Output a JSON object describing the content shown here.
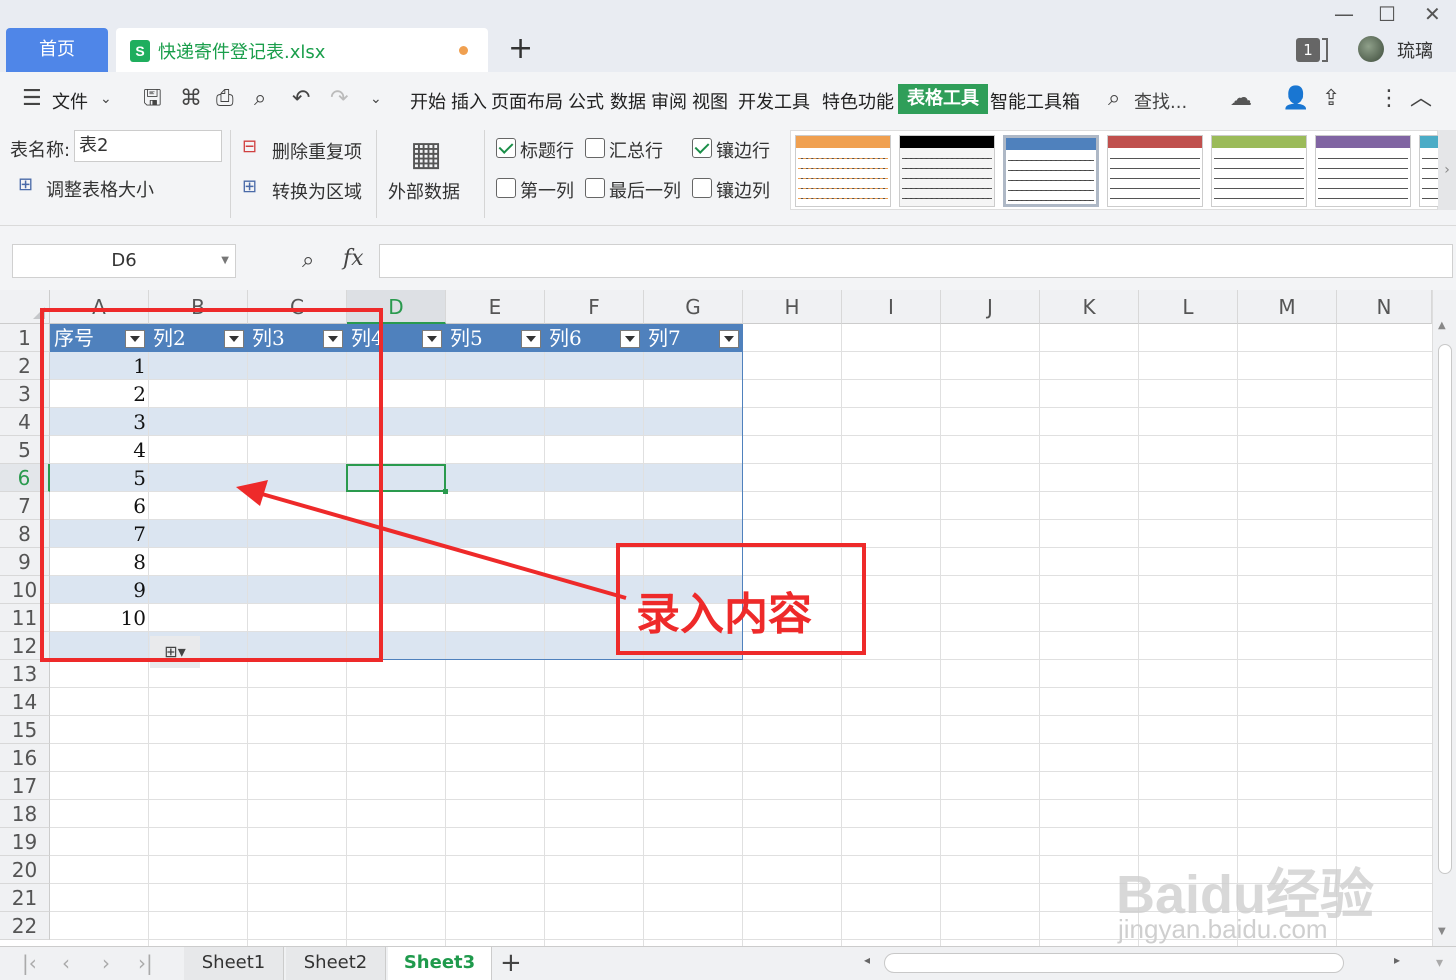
{
  "tabs": {
    "home": "首页",
    "file_name": "快递寄件登记表.xlsx",
    "new_tab": "+"
  },
  "window": {
    "counter": "1",
    "username": "琉璃"
  },
  "menu": {
    "file": "文件",
    "items": [
      "开始",
      "插入",
      "页面布局",
      "公式",
      "数据",
      "审阅",
      "视图",
      "开发工具",
      "特色功能",
      "表格工具",
      "智能工具箱"
    ],
    "active": "表格工具",
    "search": "查找..."
  },
  "ribbon": {
    "table_name_label": "表名称:",
    "table_name_value": "表2",
    "resize_table": "调整表格大小",
    "remove_duplicates": "删除重复项",
    "convert_to_range": "转换为区域",
    "external_data": "外部数据",
    "options": {
      "header_row": "标题行",
      "total_row": "汇总行",
      "banded_rows": "镶边行",
      "first_column": "第一列",
      "last_column": "最后一列",
      "banded_columns": "镶边列"
    },
    "checked": {
      "header_row": true,
      "total_row": false,
      "banded_rows": true,
      "first_column": false,
      "last_column": false,
      "banded_columns": false
    },
    "style_colors": [
      "#f0a050",
      "#000000",
      "#4f81bd",
      "#c0504d",
      "#9bbb59",
      "#8064a2",
      "#4bacc6"
    ]
  },
  "formula_bar": {
    "cell_ref": "D6",
    "fx": "fx",
    "formula": ""
  },
  "sheet": {
    "columns": [
      "A",
      "B",
      "C",
      "D",
      "E",
      "F",
      "G",
      "H",
      "I",
      "J",
      "K",
      "L",
      "M",
      "N"
    ],
    "selected_column": "D",
    "rows": [
      "1",
      "2",
      "3",
      "4",
      "5",
      "6",
      "7",
      "8",
      "9",
      "10",
      "11",
      "12",
      "13",
      "14",
      "15",
      "16",
      "17",
      "18",
      "19",
      "20",
      "21",
      "22"
    ],
    "selected_row": "6",
    "table_headers": [
      "序号",
      "列2",
      "列3",
      "列4",
      "列5",
      "列6",
      "列7"
    ],
    "serial_numbers": [
      "1",
      "2",
      "3",
      "4",
      "5",
      "6",
      "7",
      "8",
      "9",
      "10"
    ]
  },
  "annotation": {
    "label": "录入内容",
    "color": "#ee2a2a"
  },
  "watermark": {
    "logo": "Baidu经验",
    "url": "jingyan.baidu.com"
  },
  "sheet_tabs": [
    "Sheet1",
    "Sheet2",
    "Sheet3"
  ],
  "active_sheet": "Sheet3"
}
